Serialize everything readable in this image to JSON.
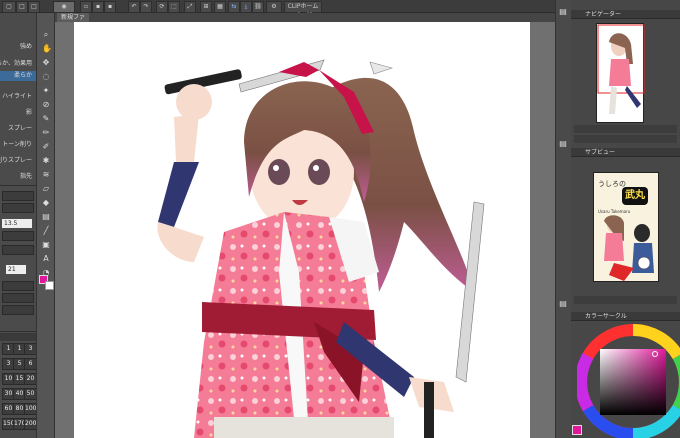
{
  "window": {
    "url_button": "CLIPホームページ"
  },
  "tabs": [
    {
      "label": "新規ファ"
    }
  ],
  "tool_options": [
    {
      "label": "強め",
      "selected": false
    },
    {
      "label": "柔らか、効果用",
      "selected": false
    },
    {
      "label": "柔らか",
      "selected": true
    },
    {
      "label": "ハイライト",
      "selected": false
    },
    {
      "label": "影",
      "selected": false
    },
    {
      "label": "スプレー",
      "selected": false
    },
    {
      "label": "トーン削り",
      "selected": false
    },
    {
      "label": "トーン削りスプレー",
      "selected": false
    },
    {
      "label": "指先",
      "selected": false
    }
  ],
  "properties": {
    "field1": "13.5",
    "field2": "21"
  },
  "brush_sizes": [
    "1",
    "1",
    "3",
    "3",
    "5",
    "6",
    "10",
    "15",
    "20",
    "30",
    "40",
    "50",
    "60",
    "80",
    "100",
    "150",
    "170",
    "200"
  ],
  "navigator": {
    "tab_label": "ナビゲーター"
  },
  "subview": {
    "tab_label": "サブビュー"
  },
  "color_wheel": {
    "tab_label": "カラーサークル"
  },
  "colors": {
    "main": "#e0199a",
    "accent": "#3c6b9a",
    "ui_dark": "#3a3a3a"
  },
  "reference_image": {
    "title_top": "うしろの",
    "title_kanji": "武丸",
    "subtitle": "Usaru Takemaru"
  },
  "icons": [
    "eye-icon",
    "hand-icon",
    "zoom-icon",
    "move-icon",
    "pen-icon",
    "brush-icon",
    "fill-icon",
    "text-icon",
    "eraser-icon",
    "rotate-icon",
    "color-swatch-icon"
  ]
}
